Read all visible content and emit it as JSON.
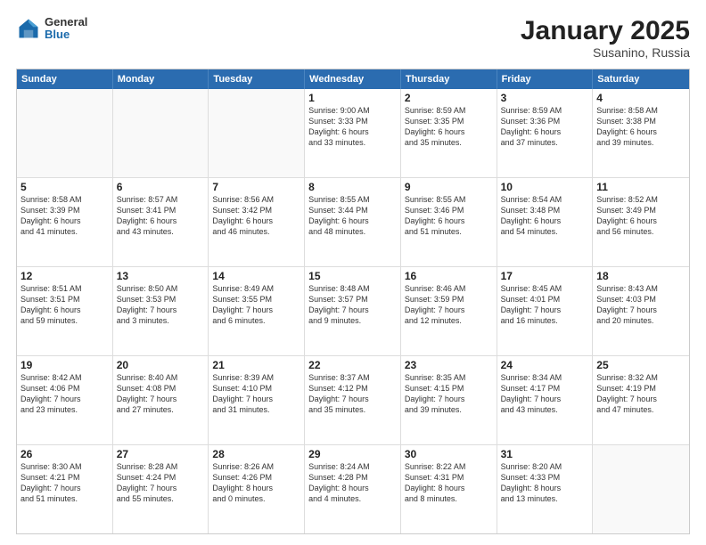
{
  "header": {
    "logo": {
      "general": "General",
      "blue": "Blue"
    },
    "title": "January 2025",
    "subtitle": "Susanino, Russia"
  },
  "weekdays": [
    "Sunday",
    "Monday",
    "Tuesday",
    "Wednesday",
    "Thursday",
    "Friday",
    "Saturday"
  ],
  "rows": [
    [
      {
        "day": "",
        "info": ""
      },
      {
        "day": "",
        "info": ""
      },
      {
        "day": "",
        "info": ""
      },
      {
        "day": "1",
        "info": "Sunrise: 9:00 AM\nSunset: 3:33 PM\nDaylight: 6 hours\nand 33 minutes."
      },
      {
        "day": "2",
        "info": "Sunrise: 8:59 AM\nSunset: 3:35 PM\nDaylight: 6 hours\nand 35 minutes."
      },
      {
        "day": "3",
        "info": "Sunrise: 8:59 AM\nSunset: 3:36 PM\nDaylight: 6 hours\nand 37 minutes."
      },
      {
        "day": "4",
        "info": "Sunrise: 8:58 AM\nSunset: 3:38 PM\nDaylight: 6 hours\nand 39 minutes."
      }
    ],
    [
      {
        "day": "5",
        "info": "Sunrise: 8:58 AM\nSunset: 3:39 PM\nDaylight: 6 hours\nand 41 minutes."
      },
      {
        "day": "6",
        "info": "Sunrise: 8:57 AM\nSunset: 3:41 PM\nDaylight: 6 hours\nand 43 minutes."
      },
      {
        "day": "7",
        "info": "Sunrise: 8:56 AM\nSunset: 3:42 PM\nDaylight: 6 hours\nand 46 minutes."
      },
      {
        "day": "8",
        "info": "Sunrise: 8:55 AM\nSunset: 3:44 PM\nDaylight: 6 hours\nand 48 minutes."
      },
      {
        "day": "9",
        "info": "Sunrise: 8:55 AM\nSunset: 3:46 PM\nDaylight: 6 hours\nand 51 minutes."
      },
      {
        "day": "10",
        "info": "Sunrise: 8:54 AM\nSunset: 3:48 PM\nDaylight: 6 hours\nand 54 minutes."
      },
      {
        "day": "11",
        "info": "Sunrise: 8:52 AM\nSunset: 3:49 PM\nDaylight: 6 hours\nand 56 minutes."
      }
    ],
    [
      {
        "day": "12",
        "info": "Sunrise: 8:51 AM\nSunset: 3:51 PM\nDaylight: 6 hours\nand 59 minutes."
      },
      {
        "day": "13",
        "info": "Sunrise: 8:50 AM\nSunset: 3:53 PM\nDaylight: 7 hours\nand 3 minutes."
      },
      {
        "day": "14",
        "info": "Sunrise: 8:49 AM\nSunset: 3:55 PM\nDaylight: 7 hours\nand 6 minutes."
      },
      {
        "day": "15",
        "info": "Sunrise: 8:48 AM\nSunset: 3:57 PM\nDaylight: 7 hours\nand 9 minutes."
      },
      {
        "day": "16",
        "info": "Sunrise: 8:46 AM\nSunset: 3:59 PM\nDaylight: 7 hours\nand 12 minutes."
      },
      {
        "day": "17",
        "info": "Sunrise: 8:45 AM\nSunset: 4:01 PM\nDaylight: 7 hours\nand 16 minutes."
      },
      {
        "day": "18",
        "info": "Sunrise: 8:43 AM\nSunset: 4:03 PM\nDaylight: 7 hours\nand 20 minutes."
      }
    ],
    [
      {
        "day": "19",
        "info": "Sunrise: 8:42 AM\nSunset: 4:06 PM\nDaylight: 7 hours\nand 23 minutes."
      },
      {
        "day": "20",
        "info": "Sunrise: 8:40 AM\nSunset: 4:08 PM\nDaylight: 7 hours\nand 27 minutes."
      },
      {
        "day": "21",
        "info": "Sunrise: 8:39 AM\nSunset: 4:10 PM\nDaylight: 7 hours\nand 31 minutes."
      },
      {
        "day": "22",
        "info": "Sunrise: 8:37 AM\nSunset: 4:12 PM\nDaylight: 7 hours\nand 35 minutes."
      },
      {
        "day": "23",
        "info": "Sunrise: 8:35 AM\nSunset: 4:15 PM\nDaylight: 7 hours\nand 39 minutes."
      },
      {
        "day": "24",
        "info": "Sunrise: 8:34 AM\nSunset: 4:17 PM\nDaylight: 7 hours\nand 43 minutes."
      },
      {
        "day": "25",
        "info": "Sunrise: 8:32 AM\nSunset: 4:19 PM\nDaylight: 7 hours\nand 47 minutes."
      }
    ],
    [
      {
        "day": "26",
        "info": "Sunrise: 8:30 AM\nSunset: 4:21 PM\nDaylight: 7 hours\nand 51 minutes."
      },
      {
        "day": "27",
        "info": "Sunrise: 8:28 AM\nSunset: 4:24 PM\nDaylight: 7 hours\nand 55 minutes."
      },
      {
        "day": "28",
        "info": "Sunrise: 8:26 AM\nSunset: 4:26 PM\nDaylight: 8 hours\nand 0 minutes."
      },
      {
        "day": "29",
        "info": "Sunrise: 8:24 AM\nSunset: 4:28 PM\nDaylight: 8 hours\nand 4 minutes."
      },
      {
        "day": "30",
        "info": "Sunrise: 8:22 AM\nSunset: 4:31 PM\nDaylight: 8 hours\nand 8 minutes."
      },
      {
        "day": "31",
        "info": "Sunrise: 8:20 AM\nSunset: 4:33 PM\nDaylight: 8 hours\nand 13 minutes."
      },
      {
        "day": "",
        "info": ""
      }
    ]
  ]
}
